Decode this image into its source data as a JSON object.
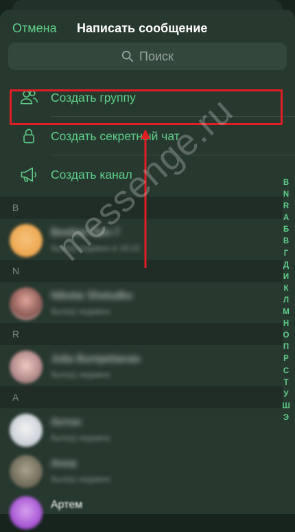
{
  "header": {
    "cancel_label": "Отмена",
    "title": "Написать сообщение"
  },
  "search": {
    "placeholder": "Поиск"
  },
  "actions": [
    {
      "label": "Создать группу",
      "icon": "group-icon"
    },
    {
      "label": "Создать секретный чат",
      "icon": "lock-icon"
    },
    {
      "label": "Создать канал",
      "icon": "megaphone-icon"
    }
  ],
  "alphabet_index": [
    "B",
    "N",
    "R",
    "A",
    "Б",
    "В",
    "Г",
    "Д",
    "И",
    "К",
    "Л",
    "М",
    "Н",
    "О",
    "П",
    "Р",
    "С",
    "Т",
    "У",
    "Ш",
    "Э"
  ],
  "sections": [
    {
      "letter": "B",
      "contacts": [
        {
          "name": "Beeline Пин-7",
          "status": "был(а) недавно в 18:22"
        }
      ]
    },
    {
      "letter": "N",
      "contacts": [
        {
          "name": "Nikolai Sheludko",
          "status": "был(а) недавно"
        }
      ]
    },
    {
      "letter": "R",
      "contacts": [
        {
          "name": "Julia Bumpetianas",
          "status": "был(а) недавно"
        }
      ]
    },
    {
      "letter": "A",
      "contacts": [
        {
          "name": "Антон",
          "status": "был(а) недавно"
        },
        {
          "name": "Анна",
          "status": "был(а) недавно"
        },
        {
          "name": "Артем",
          "status": ""
        }
      ]
    }
  ],
  "watermark": "messenge.ru",
  "colors": {
    "accent": "#5fd08a",
    "highlight": "#e01e24",
    "background": "#27382f"
  }
}
